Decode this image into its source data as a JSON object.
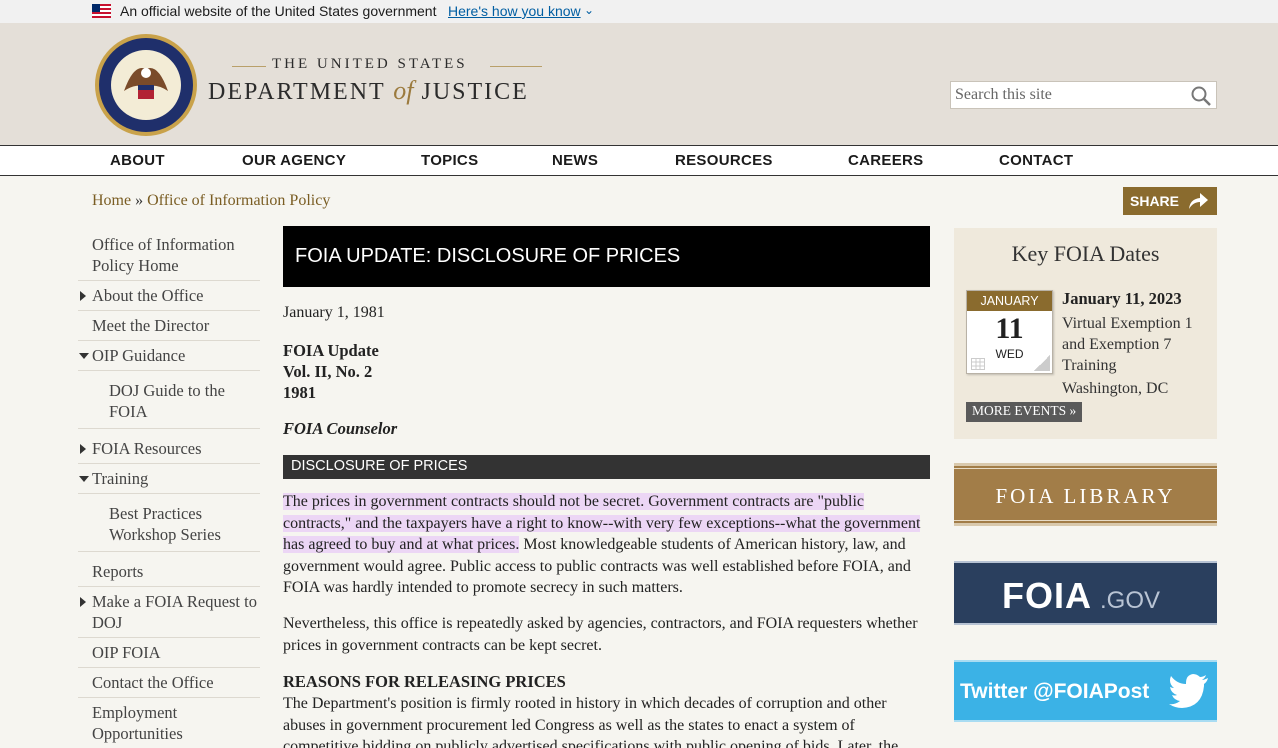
{
  "gov_banner": {
    "text": "An official website of the United States government",
    "link": "Here's how you know"
  },
  "header": {
    "brand_line1": "THE UNITED STATES",
    "brand_dept": "DEPARTMENT",
    "brand_of": "of",
    "brand_justice": "JUSTICE",
    "search_placeholder": "Search this site"
  },
  "nav": {
    "items": [
      "ABOUT",
      "OUR AGENCY",
      "TOPICS",
      "NEWS",
      "RESOURCES",
      "CAREERS",
      "CONTACT"
    ]
  },
  "breadcrumb": {
    "home": "Home",
    "sep": " » ",
    "current": "Office of Information Policy"
  },
  "share_label": "SHARE",
  "sidebar": {
    "items": [
      {
        "label": "Office of Information Policy Home"
      },
      {
        "label": "About the Office"
      },
      {
        "label": "Meet the Director"
      },
      {
        "label": "OIP Guidance"
      },
      {
        "label": "DOJ Guide to the FOIA"
      },
      {
        "label": "FOIA Resources"
      },
      {
        "label": "Training"
      },
      {
        "label": "Best Practices Workshop Series"
      },
      {
        "label": "Reports"
      },
      {
        "label": "Make a FOIA Request to DOJ"
      },
      {
        "label": "OIP FOIA"
      },
      {
        "label": "Contact the Office"
      },
      {
        "label": "Employment Opportunities"
      }
    ]
  },
  "article": {
    "title": "FOIA UPDATE: DISCLOSURE OF PRICES",
    "date": "January 1, 1981",
    "update_line1": "FOIA Update",
    "update_line2": "Vol. II, No. 2",
    "update_line3": "1981",
    "counselor": "FOIA Counselor",
    "section_heading": "DISCLOSURE OF PRICES",
    "para1_highlighted": "The prices in government contracts should not be secret. Government contracts are \"public contracts,\" and the taxpayers have a right to know--with very few exceptions--what the government has agreed to buy and at what prices.",
    "para1_rest": " Most knowledgeable students of American history, law, and government would agree. Public access to public contracts was well established before FOIA, and FOIA was hardly intended to promote secrecy in such matters.",
    "para2": "Nevertheless, this office is repeatedly asked by agencies, contractors, and FOIA requesters whether prices in government contracts can be kept secret.",
    "reasons_heading": "REASONS FOR RELEASING PRICES",
    "para3": "The Department's position is firmly rooted in history in which decades of corruption and other abuses in government procurement led Congress as well as the states to enact a system of competitive bidding on publicly advertised specifications with public opening of bids. Later, the"
  },
  "key_dates": {
    "title": "Key FOIA Dates",
    "cal_month": "JANUARY",
    "cal_day": "11",
    "cal_dow": "WED",
    "event_date": "January 11, 2023",
    "event_title": "Virtual Exemption 1 and Exemption 7 Training",
    "event_location": "Washington, DC",
    "more_events": "MORE EVENTS »"
  },
  "promos": {
    "library": "FOIA LIBRARY",
    "foiagov_a": "FOIA",
    "foiagov_b": ".GOV",
    "twitter": "Twitter @FOIAPost"
  },
  "colors": {
    "header_bg": "#e4dfd8",
    "accent_gold": "#8a6b2e",
    "link": "#7a5d23",
    "highlight": "#ecd6f5"
  }
}
